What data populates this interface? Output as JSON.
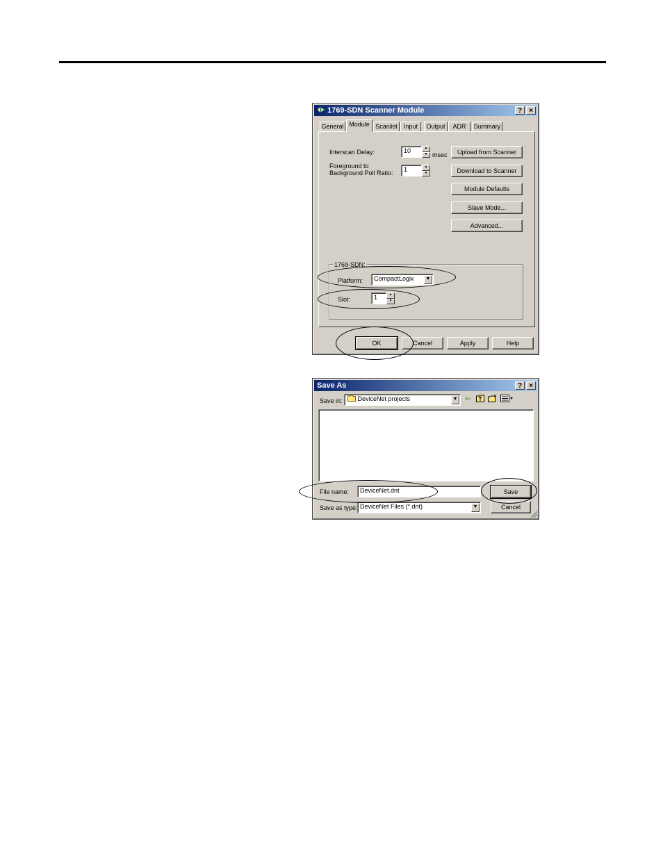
{
  "scanner_dialog": {
    "title": "1769-SDN Scanner Module",
    "help_button": "?",
    "close_button": "×",
    "tabs": [
      "General",
      "Module",
      "Scanlist",
      "Input",
      "Output",
      "ADR",
      "Summary"
    ],
    "active_tab": "Module",
    "interscan_delay_label": "Interscan Delay:",
    "interscan_delay_value": "10",
    "interscan_delay_unit": "msec",
    "poll_ratio_label_line1": "Foreground to",
    "poll_ratio_label_line2": "Background Poll Ratio:",
    "poll_ratio_value": "1",
    "side_buttons": [
      "Upload from Scanner",
      "Download to Scanner",
      "Module Defaults",
      "Slave Mode...",
      "Advanced..."
    ],
    "group_title": "1769-SDN:",
    "platform_label": "Platform:",
    "platform_value": "CompactLogix",
    "slot_label": "Slot:",
    "slot_value": "1",
    "footer_buttons": [
      "OK",
      "Cancel",
      "Apply",
      "Help"
    ]
  },
  "save_as_dialog": {
    "title": "Save As",
    "help_button": "?",
    "close_button": "×",
    "save_in_label": "Save in:",
    "save_in_value": "DeviceNet projects",
    "file_name_label": "File name:",
    "file_name_value": "DeviceNet.dnt",
    "save_as_type_label": "Save as type:",
    "save_as_type_value": "DeviceNet Files (*.dnt)",
    "save_button": "Save",
    "cancel_button": "Cancel"
  },
  "colors": {
    "dialog_face": "#d4d0c8",
    "title_start": "#0a246a",
    "title_end": "#a6caf0",
    "cursor_fill": "#ffff00"
  }
}
